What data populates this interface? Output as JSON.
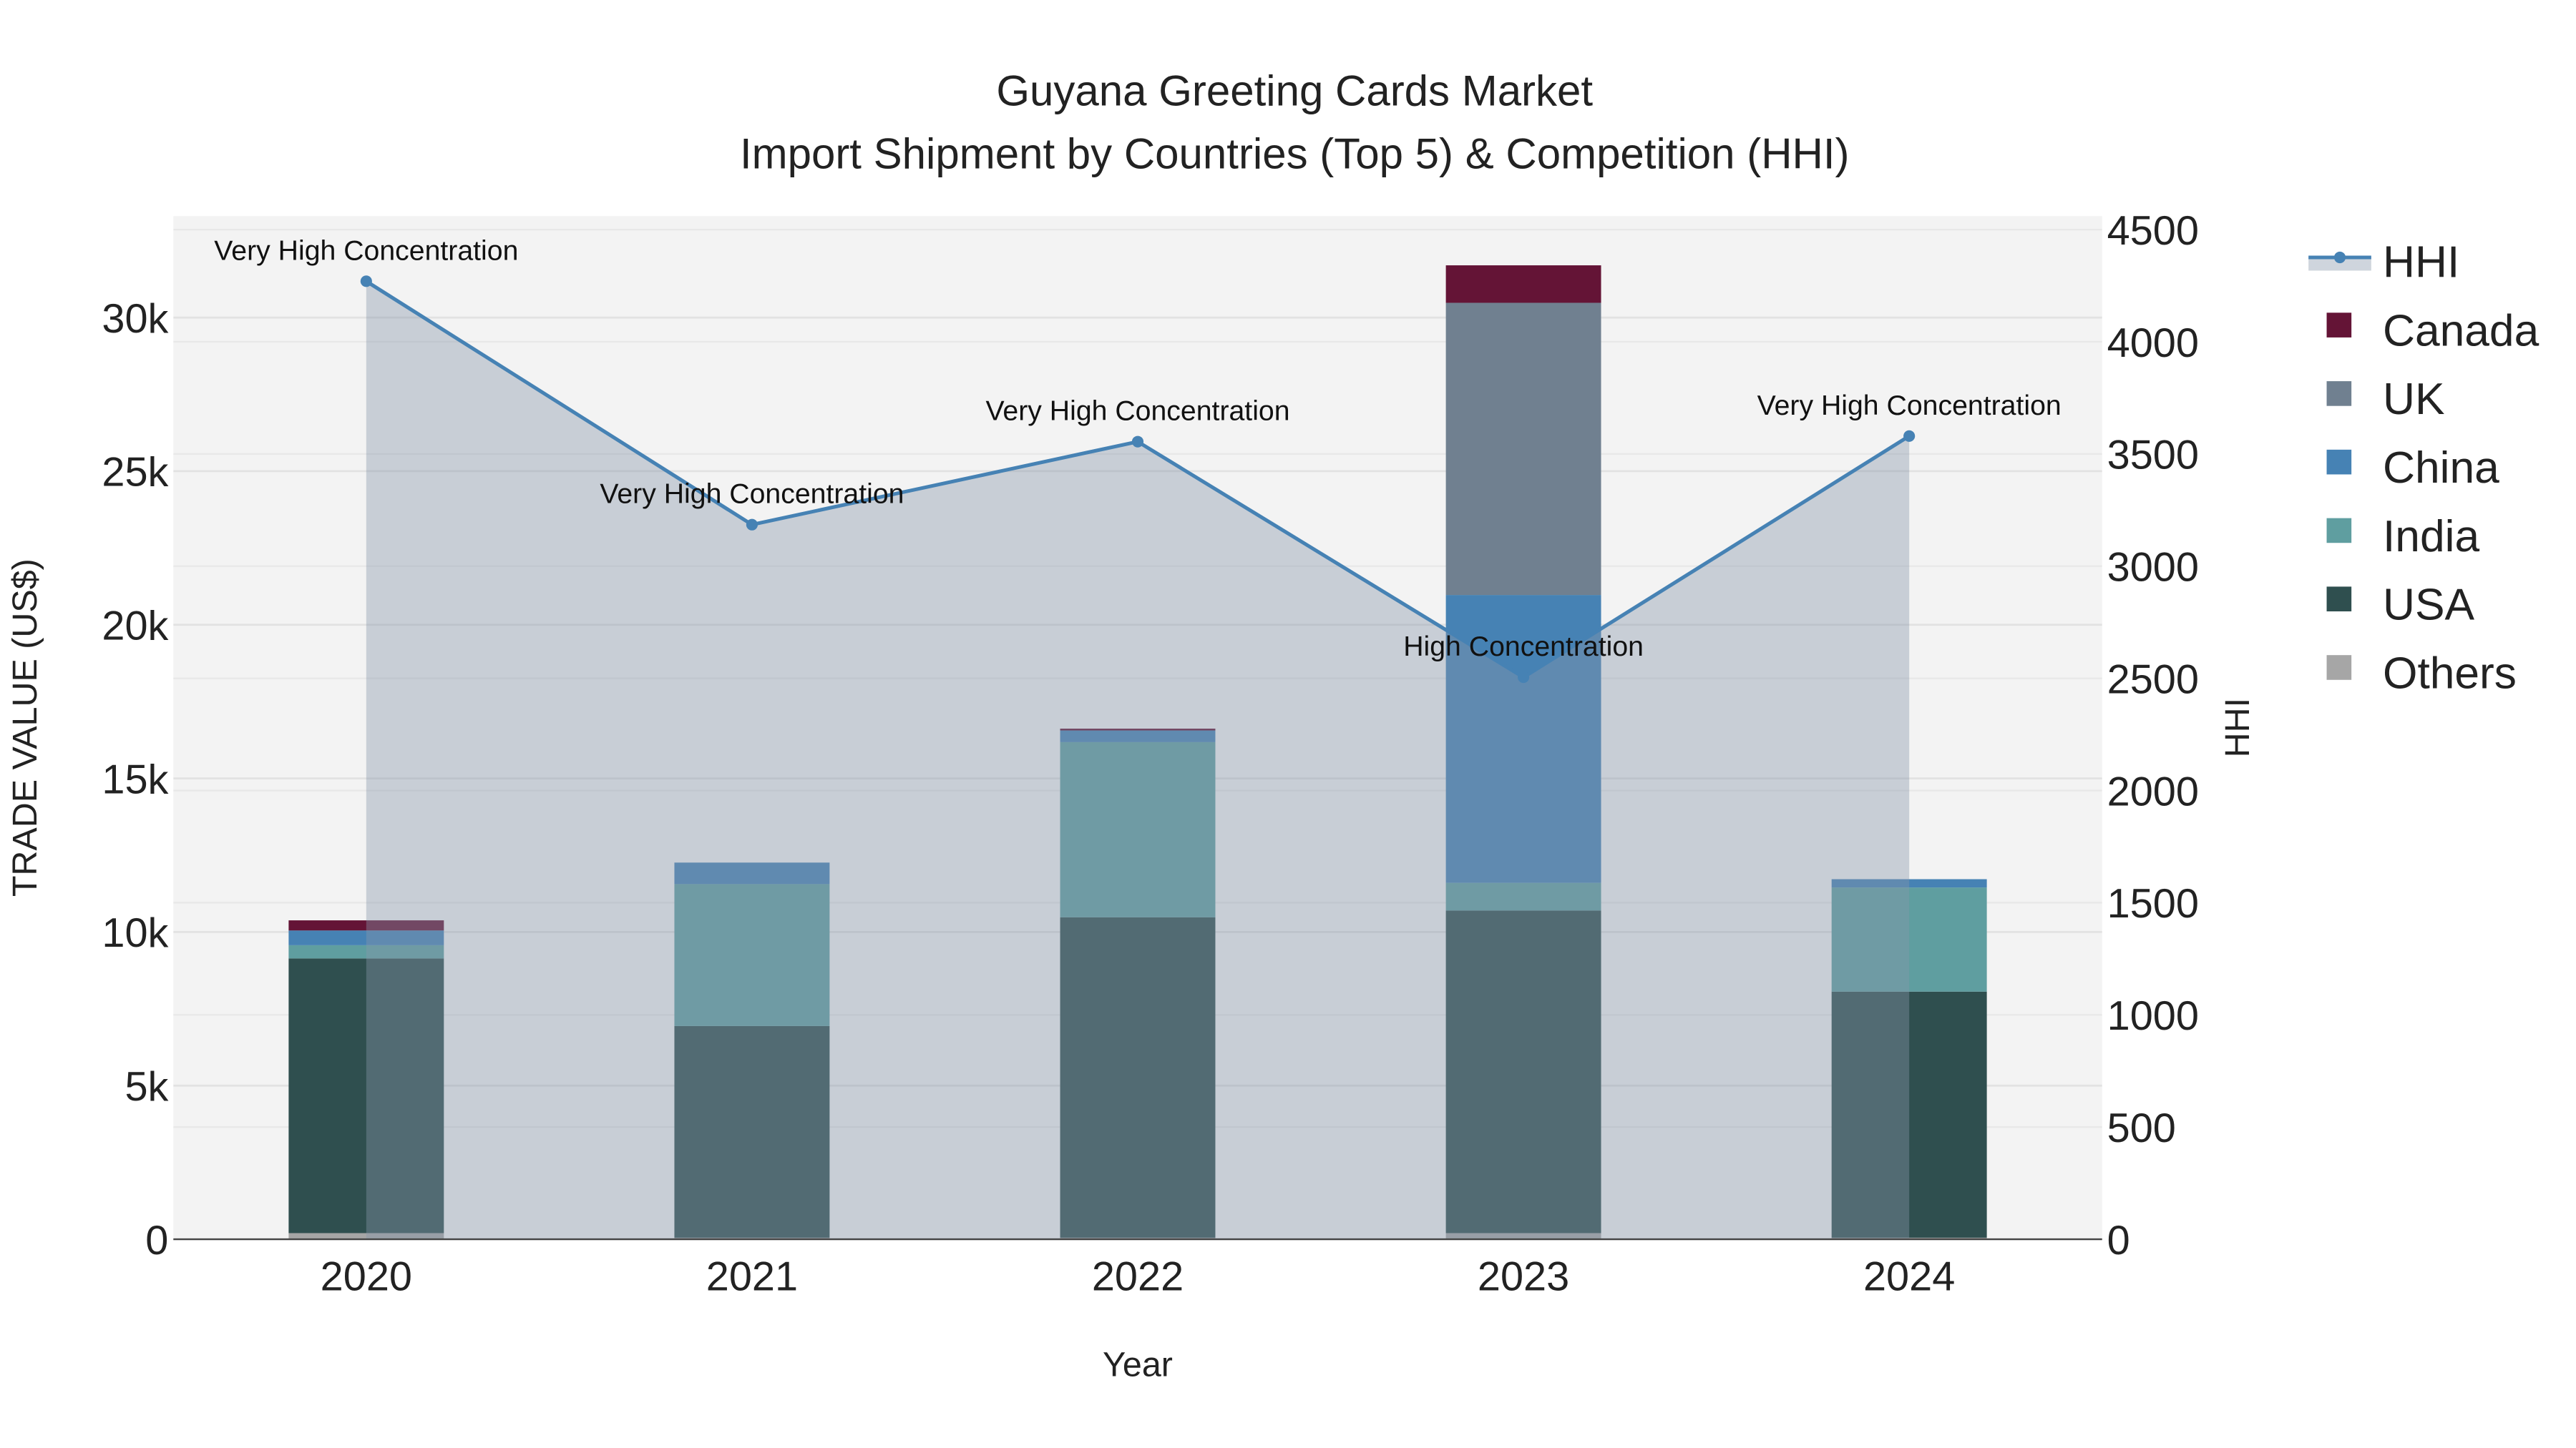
{
  "chart_data": {
    "type": "bar",
    "title": "Guyana Greeting Cards Market",
    "subtitle": "Import Shipment by Countries (Top 5) & Competition (HHI)",
    "xlabel": "Year",
    "ylabel": "TRADE VALUE (US$)",
    "y2label": "HHI",
    "categories": [
      "2020",
      "2021",
      "2022",
      "2023",
      "2024"
    ],
    "ylim": [
      0,
      33300
    ],
    "y2lim": [
      0,
      4560
    ],
    "yticks": [
      {
        "v": 0,
        "label": "0"
      },
      {
        "v": 5000,
        "label": "5k"
      },
      {
        "v": 10000,
        "label": "10k"
      },
      {
        "v": 15000,
        "label": "15k"
      },
      {
        "v": 20000,
        "label": "20k"
      },
      {
        "v": 25000,
        "label": "25k"
      },
      {
        "v": 30000,
        "label": "30k"
      }
    ],
    "y2ticks": [
      {
        "v": 0,
        "label": "0"
      },
      {
        "v": 500,
        "label": "500"
      },
      {
        "v": 1000,
        "label": "1000"
      },
      {
        "v": 1500,
        "label": "1500"
      },
      {
        "v": 2000,
        "label": "2000"
      },
      {
        "v": 2500,
        "label": "2500"
      },
      {
        "v": 3000,
        "label": "3000"
      },
      {
        "v": 3500,
        "label": "3500"
      },
      {
        "v": 4000,
        "label": "4000"
      },
      {
        "v": 4500,
        "label": "4500"
      }
    ],
    "series": [
      {
        "name": "Others",
        "color": "#a6a6a6",
        "values": [
          200,
          50,
          50,
          200,
          50
        ]
      },
      {
        "name": "USA",
        "color": "#2f4f4f",
        "values": [
          8940,
          6890,
          10430,
          10500,
          8010
        ]
      },
      {
        "name": "India",
        "color": "#5f9ea0",
        "values": [
          430,
          4620,
          5700,
          900,
          3390
        ]
      },
      {
        "name": "China",
        "color": "#4682b4",
        "values": [
          480,
          700,
          380,
          9370,
          270
        ]
      },
      {
        "name": "UK",
        "color": "#708090",
        "values": [
          0,
          0,
          0,
          9510,
          0
        ]
      },
      {
        "name": "Canada",
        "color": "#641436",
        "values": [
          330,
          0,
          60,
          1220,
          0
        ]
      }
    ],
    "hhi": {
      "name": "HHI",
      "color": "#4682b4",
      "values": [
        4270,
        3185,
        3555,
        2505,
        3580
      ],
      "annotations": [
        "Very High Concentration",
        "Very High Concentration",
        "Very High Concentration",
        "High Concentration",
        "Very High Concentration"
      ]
    },
    "legend": [
      "HHI",
      "Canada",
      "UK",
      "China",
      "India",
      "USA",
      "Others"
    ],
    "legend_position": "right",
    "grid": true
  }
}
